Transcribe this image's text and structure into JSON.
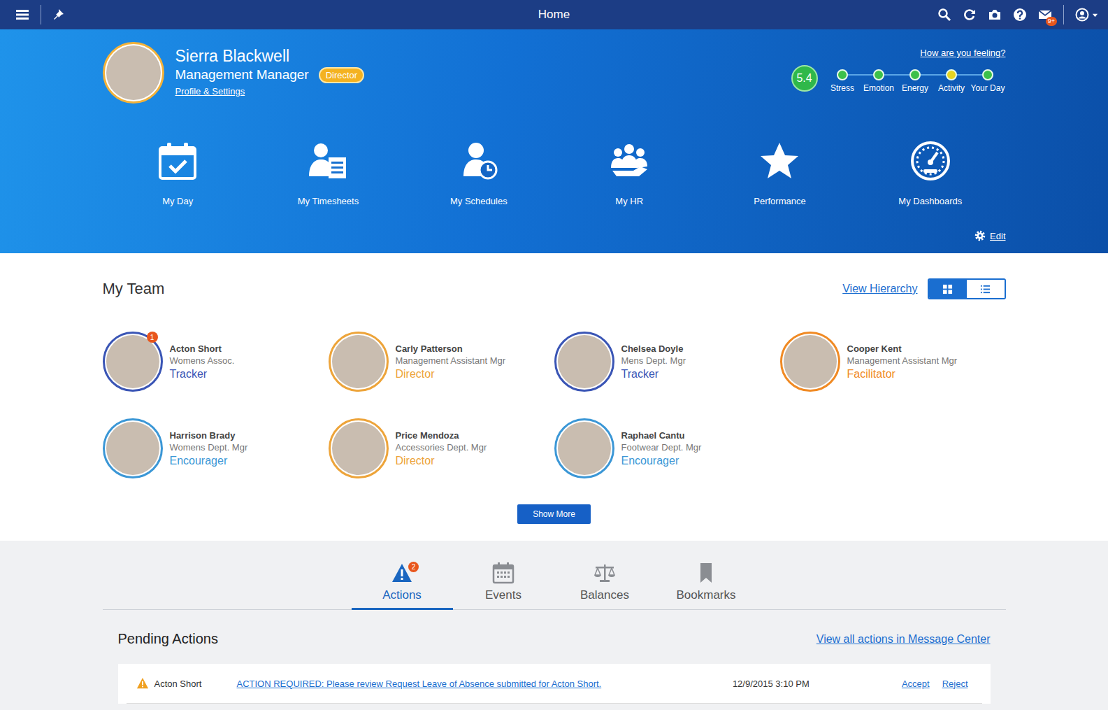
{
  "topbar": {
    "title": "Home",
    "mail_badge": "9+"
  },
  "profile": {
    "name": "Sierra Blackwell",
    "title": "Management Manager",
    "role": "Director",
    "link": "Profile & Settings"
  },
  "wellbeing": {
    "prompt": "How are you feeling?",
    "score": "5.4",
    "score_color": "#2fb84a",
    "metrics": [
      {
        "label": "Stress",
        "color": "#3cc04a"
      },
      {
        "label": "Emotion",
        "color": "#3cc04a"
      },
      {
        "label": "Energy",
        "color": "#3cc04a"
      },
      {
        "label": "Activity",
        "color": "#e6d422"
      },
      {
        "label": "Your Day",
        "color": "#3cc04a"
      }
    ]
  },
  "tiles": [
    {
      "label": "My Day",
      "kind": "calendar"
    },
    {
      "label": "My Timesheets",
      "kind": "timesheet"
    },
    {
      "label": "My Schedules",
      "kind": "schedule"
    },
    {
      "label": "My HR",
      "kind": "team"
    },
    {
      "label": "Performance",
      "kind": "star"
    },
    {
      "label": "My Dashboards",
      "kind": "gauge"
    }
  ],
  "edit": "Edit",
  "team": {
    "title": "My Team",
    "hierarchy_link": "View Hierarchy",
    "views": [
      {
        "kind": "grid",
        "selected": true
      },
      {
        "kind": "list",
        "selected": false
      }
    ],
    "members": [
      {
        "name": "Acton Short",
        "position": "Womens Assoc.",
        "role": "Tracker",
        "color": "#3a55b5",
        "badge": "1"
      },
      {
        "name": "Carly Patterson",
        "position": "Management Assistant Mgr",
        "role": "Director",
        "color": "#eda43a",
        "badge": null
      },
      {
        "name": "Chelsea Doyle",
        "position": "Mens Dept. Mgr",
        "role": "Tracker",
        "color": "#3a55b5",
        "badge": null
      },
      {
        "name": "Cooper Kent",
        "position": "Management Assistant Mgr",
        "role": "Facilitator",
        "color": "#f08a24",
        "badge": null
      },
      {
        "name": "Harrison Brady",
        "position": "Womens Dept. Mgr",
        "role": "Encourager",
        "color": "#3b97d6",
        "badge": null
      },
      {
        "name": "Price Mendoza",
        "position": "Accessories Dept. Mgr",
        "role": "Director",
        "color": "#eda43a",
        "badge": null
      },
      {
        "name": "Raphael Cantu",
        "position": "Footwear Dept. Mgr",
        "role": "Encourager",
        "color": "#3b97d6",
        "badge": null
      }
    ],
    "show_more": "Show More"
  },
  "tabs": [
    {
      "label": "Actions",
      "kind": "alert",
      "badge": "2",
      "selected": true
    },
    {
      "label": "Events",
      "kind": "calendar",
      "badge": null,
      "selected": false
    },
    {
      "label": "Balances",
      "kind": "scale",
      "badge": null,
      "selected": false
    },
    {
      "label": "Bookmarks",
      "kind": "bookmark",
      "badge": null,
      "selected": false
    }
  ],
  "pending": {
    "title": "Pending Actions",
    "link": "View all actions in Message Center",
    "rows": [
      {
        "name": "Acton Short",
        "message": "ACTION REQUIRED: Please review Request Leave of Absence submitted for Acton Short.",
        "time": "12/9/2015 3:10 PM",
        "actions": [
          "Accept",
          "Reject"
        ]
      }
    ]
  }
}
